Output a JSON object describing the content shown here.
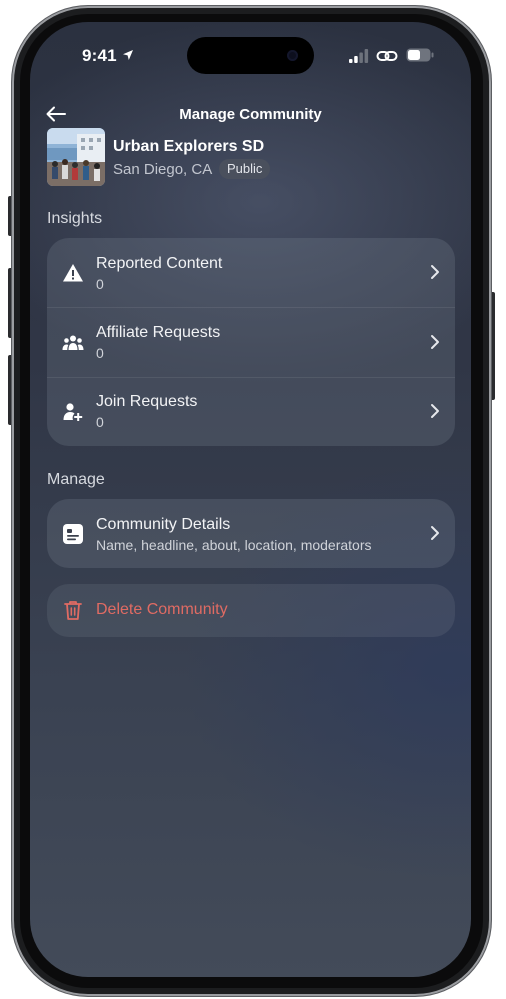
{
  "status_bar": {
    "time": "9:41"
  },
  "header": {
    "title": "Manage Community"
  },
  "community": {
    "name": "Urban Explorers SD",
    "location": "San Diego, CA",
    "visibility": "Public"
  },
  "insights": {
    "label": "Insights",
    "items": [
      {
        "title": "Reported Content",
        "count": "0",
        "icon": "warning-icon"
      },
      {
        "title": "Affiliate Requests",
        "count": "0",
        "icon": "group-icon"
      },
      {
        "title": "Join Requests",
        "count": "0",
        "icon": "add-person-icon"
      }
    ]
  },
  "manage": {
    "label": "Manage",
    "details": {
      "title": "Community Details",
      "subtitle": "Name, headline, about, location, moderators",
      "icon": "details-card-icon"
    },
    "delete": {
      "label": "Delete Community",
      "icon": "trash-icon",
      "color": "#e06b63"
    }
  }
}
